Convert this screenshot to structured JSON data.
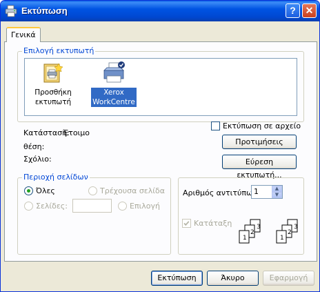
{
  "window": {
    "title": "Εκτύπωση",
    "help_label": "?",
    "close_label": "✕"
  },
  "tabs": [
    {
      "label": "Γενικά",
      "selected": true
    }
  ],
  "select_printer": {
    "group_label": "Επιλογή εκτυπωτή",
    "items": [
      {
        "label_line1": "Προσθήκη",
        "label_line2": "εκτυπωτή",
        "icon": "add-printer-icon",
        "selected": false
      },
      {
        "label_line1": "Xerox",
        "label_line2": "WorkCentre",
        "icon": "printer-icon",
        "selected": true
      }
    ]
  },
  "status": {
    "status_label": "Κατάσταση:",
    "status_value": "Έτοιμο",
    "location_label": "θέση:",
    "location_value": "",
    "comment_label": "Σχόλιο:",
    "comment_value": ""
  },
  "print_to_file": {
    "label": "Εκτύπωση σε αρχείο",
    "checked": false
  },
  "buttons": {
    "preferences": "Προτιμήσεις",
    "find_printer": "Εύρεση εκτυπωτή...",
    "print": "Εκτύπωση",
    "cancel": "Άκυρο",
    "apply": "Εφαρμογή"
  },
  "page_range": {
    "group_label": "Περιοχή σελίδων",
    "all_label": "Όλες",
    "current_page_label": "Τρέχουσα σελίδα",
    "selection_label": "Επιλογή",
    "pages_label": "Σελίδες:",
    "pages_value": "",
    "selected": "all"
  },
  "copies": {
    "copies_label": "Αριθμός αντιτύπων:",
    "copies_value": "1",
    "collate_label": "Κατάταξη",
    "collate_checked": true,
    "collate_disabled": true,
    "collate_pages": [
      "1",
      "2",
      "3"
    ]
  },
  "colors": {
    "accent": "#0054e3",
    "group_label": "#0046d5",
    "selection": "#316ac5"
  }
}
